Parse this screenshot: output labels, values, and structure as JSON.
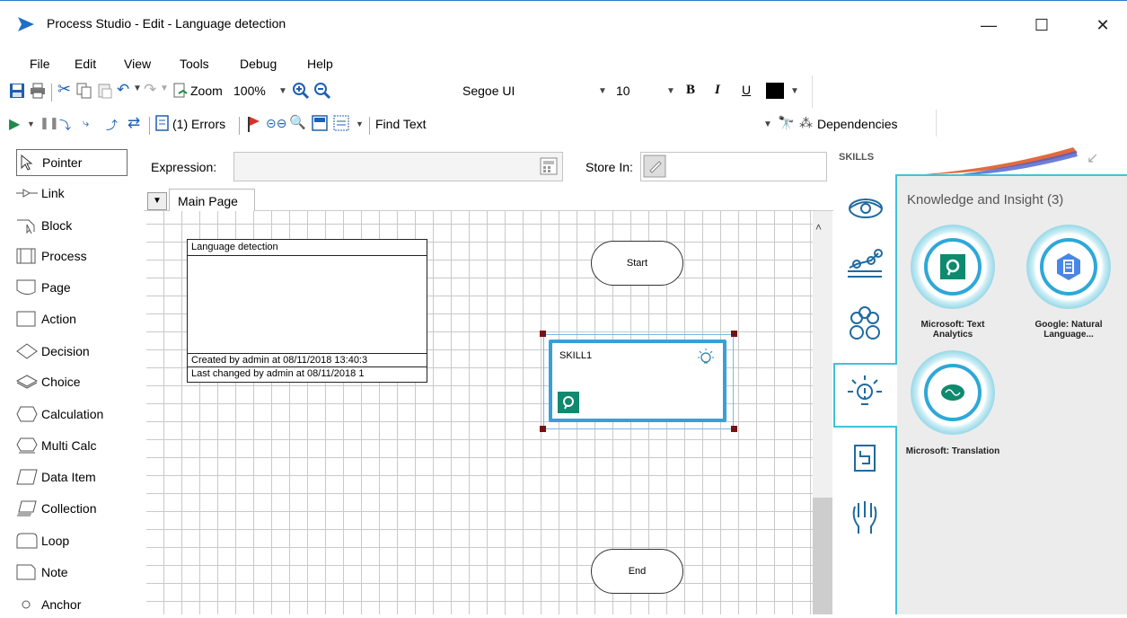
{
  "window": {
    "title": "Process Studio  - Edit - Language detection",
    "minimize": "—",
    "maximize": "☐",
    "close": "✕"
  },
  "menu": [
    "File",
    "Edit",
    "View",
    "Tools",
    "Debug",
    "Help"
  ],
  "toolbar1": {
    "zoom_label": "Zoom",
    "zoom_value": "100%",
    "font_name": "Segoe UI",
    "font_size": "10",
    "bold": "B",
    "italic": "I",
    "underline": "U"
  },
  "toolbar2": {
    "errors": "(1) Errors",
    "find_text": "Find Text",
    "dependencies": "Dependencies"
  },
  "expression_bar": {
    "expression_label": "Expression:",
    "store_in_label": "Store In:"
  },
  "page_tab": {
    "label": "Main Page"
  },
  "tools": [
    {
      "label": "Pointer",
      "icon": "pointer-icon"
    },
    {
      "label": "Link",
      "icon": "link-icon"
    },
    {
      "label": "Block",
      "icon": "block-icon"
    },
    {
      "label": "Process",
      "icon": "process-icon"
    },
    {
      "label": "Page",
      "icon": "page-icon"
    },
    {
      "label": "Action",
      "icon": "action-icon"
    },
    {
      "label": "Decision",
      "icon": "decision-icon"
    },
    {
      "label": "Choice",
      "icon": "choice-icon"
    },
    {
      "label": "Calculation",
      "icon": "calculation-icon"
    },
    {
      "label": "Multi Calc",
      "icon": "multi-calc-icon"
    },
    {
      "label": "Data Item",
      "icon": "data-item-icon"
    },
    {
      "label": "Collection",
      "icon": "collection-icon"
    },
    {
      "label": "Loop",
      "icon": "loop-icon"
    },
    {
      "label": "Note",
      "icon": "note-icon"
    },
    {
      "label": "Anchor",
      "icon": "anchor-icon"
    }
  ],
  "info_box": {
    "title": "Language detection",
    "created": "Created  by  admin  at  08/11/2018 13:40:3",
    "changed": "Last  changed  by  admin  at  08/11/2018 1"
  },
  "stages": {
    "start": "Start",
    "end": "End",
    "skill": "SKILL1"
  },
  "skills_panel": {
    "header": "SKILLS",
    "category": "Knowledge and Insight (3)",
    "skills": [
      {
        "name": "Microsoft: Text Analytics",
        "icon": "text-analytics-icon"
      },
      {
        "name": "Google: Natural Language...",
        "icon": "google-nl-icon"
      },
      {
        "name": "Microsoft: Translation",
        "icon": "translation-icon"
      }
    ]
  },
  "colors": {
    "accent": "#3fc3d8",
    "skill_border": "#3a9fd6",
    "flag": "#d9312a",
    "icon_green": "#0e8a6e"
  }
}
